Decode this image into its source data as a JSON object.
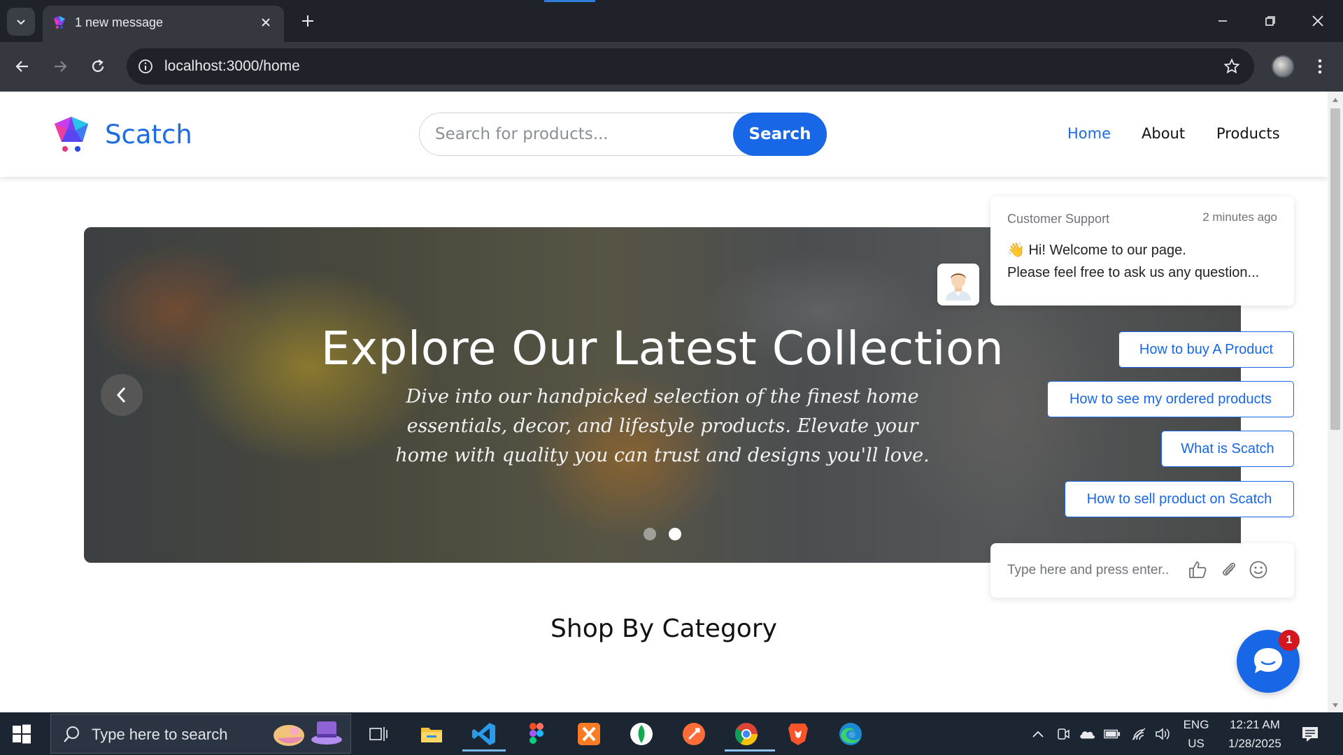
{
  "browser": {
    "tab_title": "1 new message",
    "url": "localhost:3000/home"
  },
  "site": {
    "brand": "Scatch",
    "search": {
      "placeholder": "Search for products...",
      "button_label": "Search"
    },
    "nav": [
      {
        "label": "Home",
        "active": true
      },
      {
        "label": "About",
        "active": false
      },
      {
        "label": "Products",
        "active": false
      }
    ]
  },
  "hero": {
    "title": "Explore Our Latest Collection",
    "subtitle": "Dive into our handpicked selection of the finest home essentials, decor, and lifestyle products. Elevate your home with quality you can trust and designs you'll love.",
    "slides": 2,
    "active_slide": 2
  },
  "sections": {
    "category_title": "Shop By Category"
  },
  "chat": {
    "agent": "Customer Support",
    "time": "2 minutes ago",
    "greeting": "👋 Hi! Welcome to our page.",
    "message": "Please feel free to ask us any question...",
    "quick_replies": [
      "How to buy A Product",
      "How to see my ordered products",
      "What is Scatch",
      "How to sell product on Scatch"
    ],
    "input_placeholder": "Type here and press enter..",
    "unread_badge": "1"
  },
  "taskbar": {
    "search_placeholder": "Type here to search",
    "language": "ENG",
    "region": "US",
    "time": "12:21 AM",
    "date": "1/28/2025"
  },
  "colors": {
    "accent": "#1867e6",
    "brand": "#1d6de0",
    "badge": "#d4161f"
  }
}
